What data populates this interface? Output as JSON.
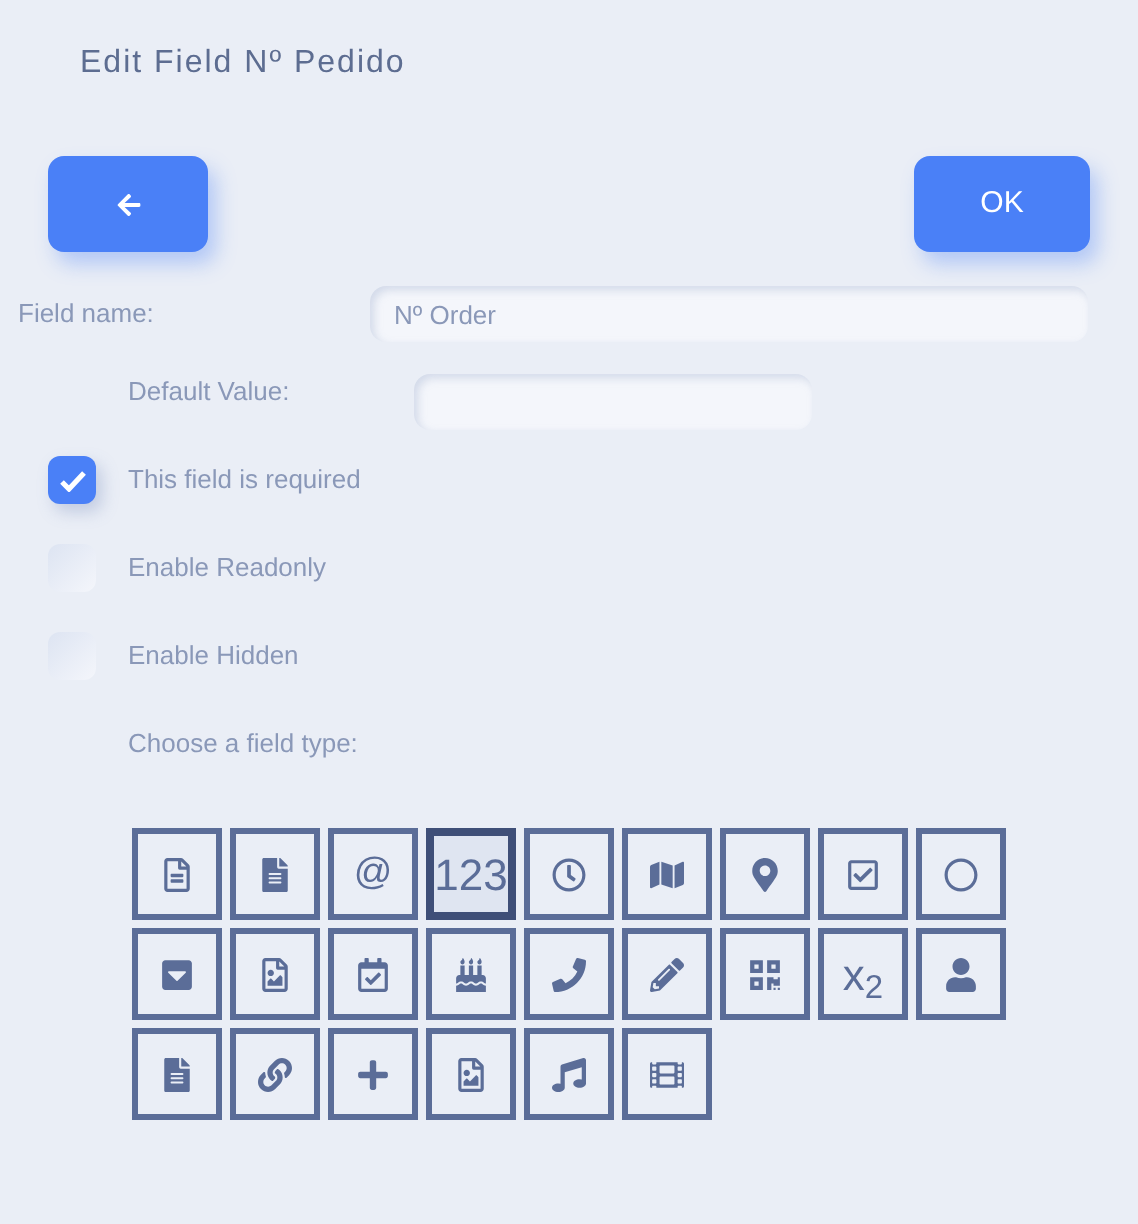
{
  "title": "Edit Field Nº Pedido",
  "ok_button": "OK",
  "field_name": {
    "label": "Field name:",
    "value": "Nº Order"
  },
  "default_value": {
    "label": "Default Value:"
  },
  "options": [
    {
      "label": "This field is required",
      "checked": true
    },
    {
      "label": "Enable Readonly",
      "checked": false
    },
    {
      "label": "Enable Hidden",
      "checked": false
    }
  ],
  "type_prompt": "Choose a field type:",
  "field_types": [
    {
      "kind": "icon",
      "selected": false
    },
    {
      "kind": "icon",
      "selected": false
    },
    {
      "kind": "text",
      "label": "@",
      "selected": false
    },
    {
      "kind": "text",
      "label": "123",
      "selected": true
    },
    {
      "kind": "icon",
      "selected": false
    },
    {
      "kind": "icon",
      "selected": false
    },
    {
      "kind": "icon",
      "selected": false
    },
    {
      "kind": "icon",
      "selected": false
    },
    {
      "kind": "icon",
      "selected": false
    },
    {
      "kind": "icon",
      "selected": false
    },
    {
      "kind": "icon",
      "selected": false
    },
    {
      "kind": "icon",
      "selected": false
    },
    {
      "kind": "icon",
      "selected": false
    },
    {
      "kind": "icon",
      "selected": false
    },
    {
      "kind": "icon",
      "selected": false
    },
    {
      "kind": "icon",
      "selected": false
    },
    {
      "kind": "text",
      "label": "x$_{2}$",
      "selected": false
    },
    {
      "kind": "icon",
      "selected": false
    },
    {
      "kind": "icon",
      "selected": false
    },
    {
      "kind": "icon",
      "selected": false
    },
    {
      "kind": "icon",
      "selected": false
    },
    {
      "kind": "icon",
      "selected": false
    },
    {
      "kind": "icon",
      "selected": false
    },
    {
      "kind": "icon",
      "selected": false
    }
  ]
}
